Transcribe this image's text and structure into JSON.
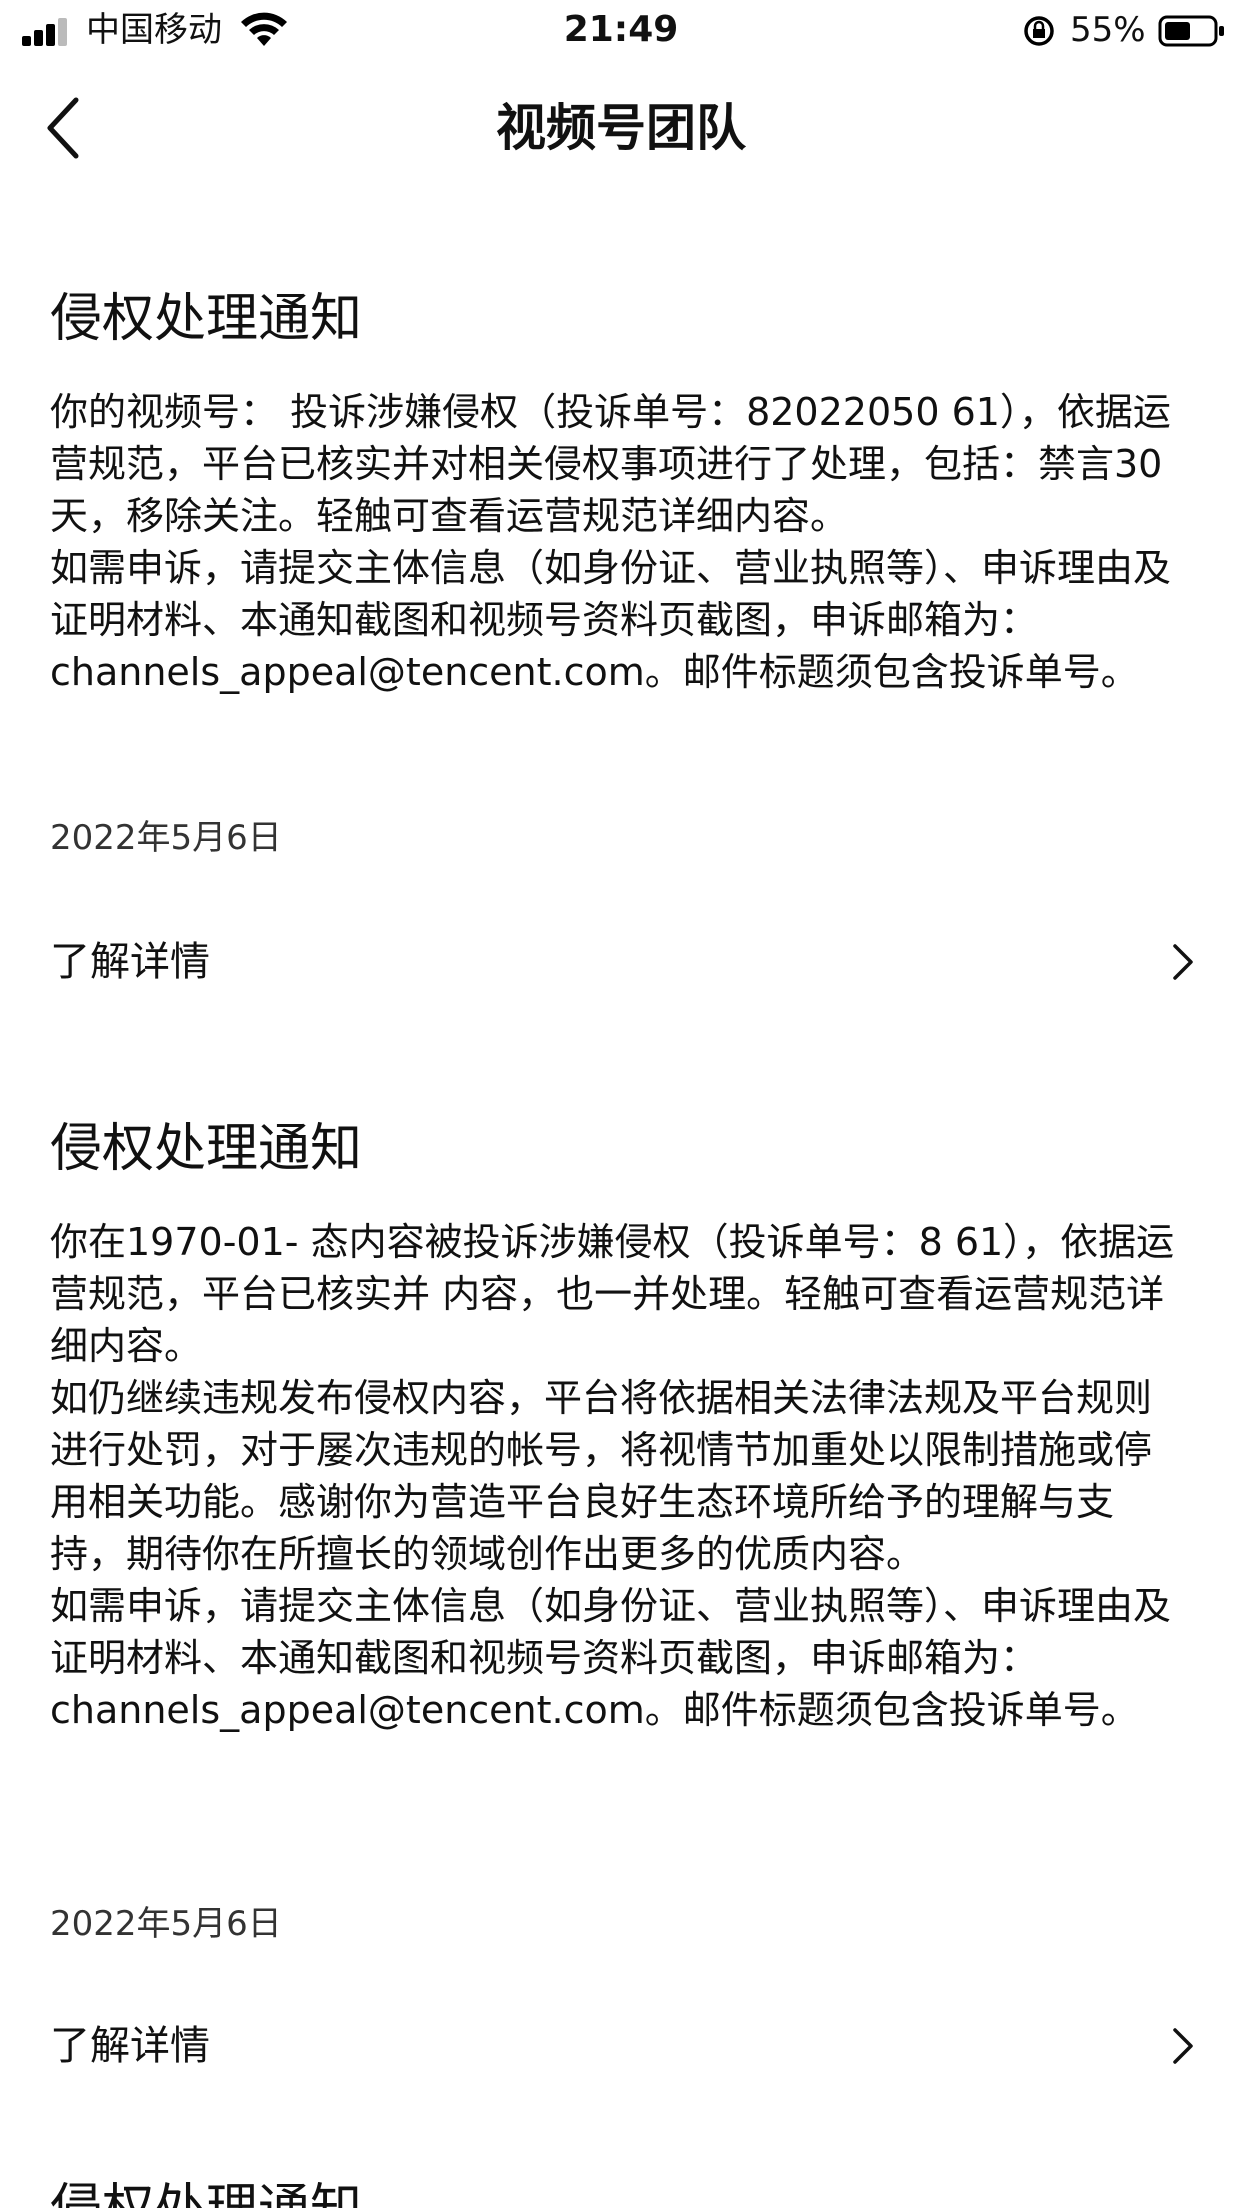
{
  "status_bar": {
    "carrier": "中国移动",
    "time": "21:49",
    "battery_percent": "55%",
    "battery_level": 0.55,
    "icons": [
      "signal-icon",
      "wifi-icon",
      "rotation-lock-icon",
      "battery-icon"
    ]
  },
  "nav": {
    "title": "视频号团队",
    "back_icon": "chevron-left-icon"
  },
  "notices": [
    {
      "title": "侵权处理通知",
      "paragraphs": [
        "你的视频号：        投诉涉嫌侵权（投诉单号：82022050        61），依据运营规范，平台已核实并对相关侵权事项进行了处理，包括：禁言30天，移除关注。轻触可查看运营规范详细内容。",
        "如需申诉，请提交主体信息（如身份证、营业执照等）、申诉理由及证明材料、本通知截图和视频号资料页截图，申诉邮箱为：channels_appeal@tencent.com。邮件标题须包含投诉单号。"
      ],
      "date": "2022年5月6日",
      "detail_label": "了解详情"
    },
    {
      "title": "侵权处理通知",
      "paragraphs": [
        "你在1970-01-                态内容被投诉涉嫌侵权（投诉单号：8                61），依据运营规范，平台已核实并        内容，也一并处理。轻触可查看运营规范详细内容。",
        "如仍继续违规发布侵权内容，平台将依据相关法律法规及平台规则进行处罚，对于屡次违规的帐号，将视情节加重处以限制措施或停用相关功能。感谢你为营造平台良好生态环境所给予的理解与支持，期待你在所擅长的领域创作出更多的优质内容。",
        "如需申诉，请提交主体信息（如身份证、营业执照等）、申诉理由及证明材料、本通知截图和视频号资料页截图，申诉邮箱为：channels_appeal@tencent.com。邮件标题须包含投诉单号。"
      ],
      "date": "2022年5月6日",
      "detail_label": "了解详情"
    },
    {
      "title": "侵权处理通知"
    }
  ]
}
